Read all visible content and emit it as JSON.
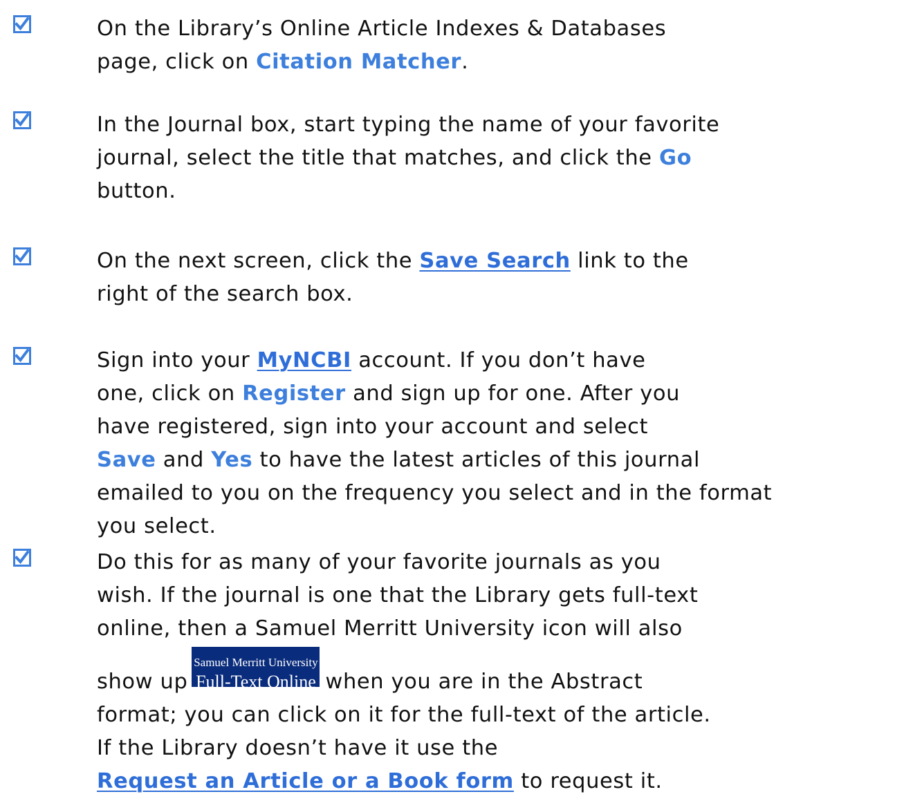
{
  "colors": {
    "check": "#3d7fdc",
    "highlight": "#3d7fdc",
    "link": "#2f6ed8",
    "badge_bg": "#0a2c7c",
    "text": "#111111"
  },
  "icons": {
    "step_marker": "checked-checkbox-icon"
  },
  "steps": [
    {
      "p1": "On the Library’s Online Article Indexes & Databases",
      "p2": "page, click on ",
      "h1": "Citation Matcher",
      "p3": "."
    },
    {
      "p1": "In the Journal box, start typing the name of your favorite",
      "p2": "journal, select the title that matches, and click the ",
      "h1": "Go",
      "p3": "button."
    },
    {
      "p1": "On the next screen, click the ",
      "link": "Save Search",
      "p2": " link to the",
      "p3": "right of the search box."
    },
    {
      "p1": "Sign into your ",
      "link": "MyNCBI",
      "p2": " account. If you don’t have",
      "p3": "one, click on ",
      "h1": "Register",
      "p4": " and sign up for one. After you",
      "p5": "have registered, sign into your account and select",
      "h2": "Save",
      "p6": " and ",
      "h3": "Yes",
      "p7": " to have the latest articles of this journal",
      "p8": "emailed to you on the frequency you select and in the format",
      "p9": "you select."
    },
    {
      "p1": "Do this for as many of your favorite journals as you",
      "p2": "wish. If the journal is one that the Library gets full-text",
      "p3": "online, then a Samuel Merritt University icon will also",
      "p4": "show up",
      "p5": "when you are in the Abstract",
      "p6": "format; you can click on it for the full-text of the article.",
      "p7": "If the Library doesn’t have it use the",
      "link": "Request an Article or a Book form",
      "p8": " to request it."
    }
  ],
  "badge": {
    "line1": "Samuel Merritt University",
    "line2": "Full-Text Online"
  }
}
